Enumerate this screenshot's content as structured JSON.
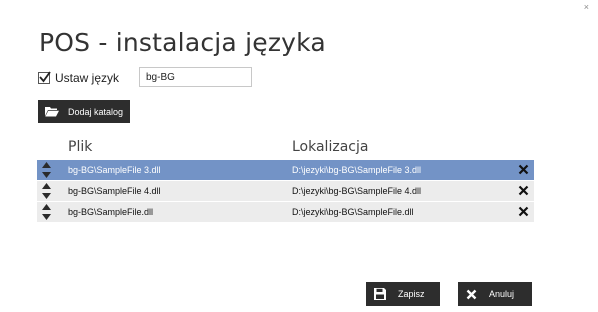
{
  "window": {
    "close_glyph": "×",
    "title": "POS - instalacja języka"
  },
  "language": {
    "checkbox_checked": true,
    "checkbox_label": "Ustaw język",
    "value": "bg-BG"
  },
  "toolbar": {
    "add_catalog_label": "Dodaj katalog",
    "add_catalog_icon": "folder-open-icon"
  },
  "table": {
    "headers": {
      "file": "Plik",
      "location": "Lokalizacja"
    },
    "rows": [
      {
        "file": "bg-BG\\SampleFile 3.dll",
        "location": "D:\\jezyki\\bg-BG\\SampleFile 3.dll",
        "selected": true
      },
      {
        "file": "bg-BG\\SampleFile 4.dll",
        "location": "D:\\jezyki\\bg-BG\\SampleFile 4.dll",
        "selected": false
      },
      {
        "file": "bg-BG\\SampleFile.dll",
        "location": "D:\\jezyki\\bg-BG\\SampleFile.dll",
        "selected": false
      }
    ],
    "selected_color": "#7393c6",
    "row_color": "#ececec"
  },
  "footer": {
    "save_label": "Zapisz",
    "save_icon": "floppy-disk-icon",
    "cancel_label": "Anuluj",
    "cancel_icon": "close-icon"
  }
}
